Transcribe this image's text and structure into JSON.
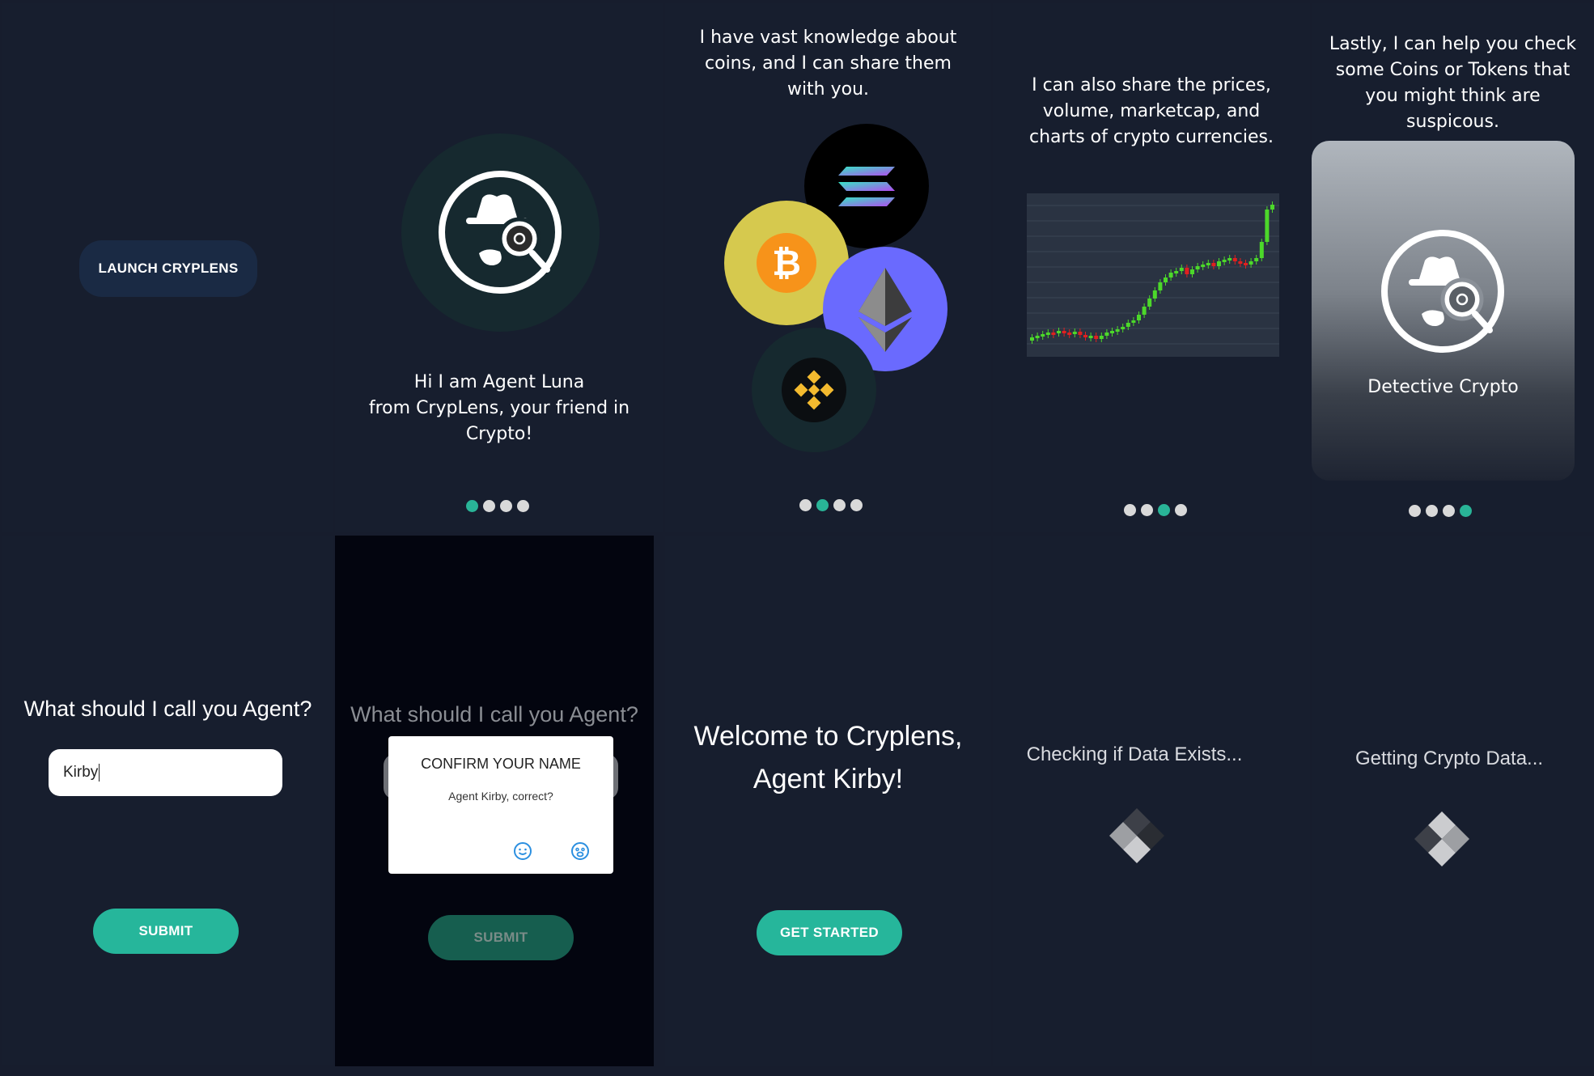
{
  "screen1": {
    "launch_label": "LAUNCH CRYPLENS"
  },
  "screen2": {
    "intro": "Hi I am Agent Luna\nfrom CrypLens, your friend in\nCrypto!",
    "active_dot": 0
  },
  "screen3": {
    "text": "I have vast knowledge about\ncoins, and I can share them\nwith you.",
    "active_dot": 1,
    "coins": [
      "solana-icon",
      "bitcoin-icon",
      "ethereum-icon",
      "binance-icon"
    ]
  },
  "screen4": {
    "text": "I can also share the prices,\nvolume, marketcap, and\ncharts of crypto currencies.",
    "active_dot": 2
  },
  "screen5": {
    "text": "Lastly, I can help you check\nsome Coins or Tokens that\nyou might think are\nsuspicous.",
    "card_label": "Detective Crypto",
    "active_dot": 3
  },
  "screen6": {
    "question": "What should I call you Agent?",
    "name_value": "Kirby",
    "submit_label": "SUBMIT"
  },
  "screen7": {
    "question": "What should I call you Agent?",
    "dialog_title": "CONFIRM YOUR NAME",
    "dialog_message": "Agent Kirby, correct?",
    "submit_label": "SUBMIT"
  },
  "screen8": {
    "welcome": "Welcome to Cryplens,\nAgent Kirby!",
    "get_started_label": "GET STARTED"
  },
  "screen9": {
    "status": "Checking if Data Exists..."
  },
  "screen10": {
    "status": "Getting Crypto Data..."
  },
  "colors": {
    "accent": "#26b69b",
    "background": "#171e2e",
    "binance": "#f3ba2f",
    "bitcoin": "#f7931a",
    "ethereum_bg": "#6a6afe"
  }
}
